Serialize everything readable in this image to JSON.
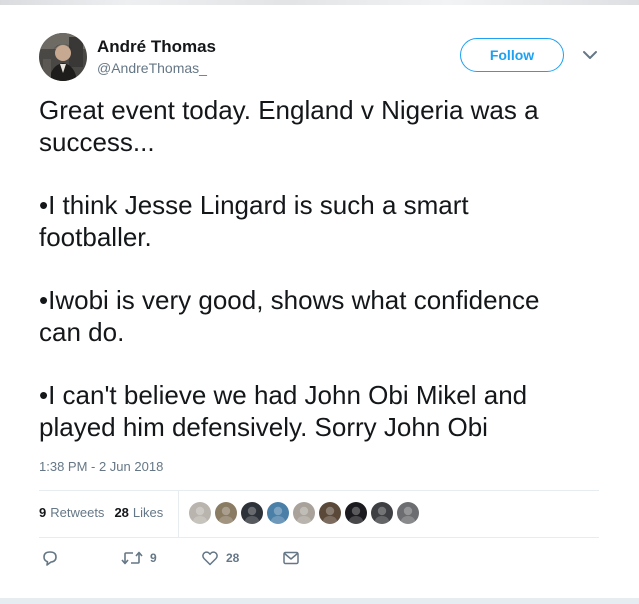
{
  "tweet": {
    "author": {
      "display_name": "André Thomas",
      "handle": "@AndreThomas_"
    },
    "follow_label": "Follow",
    "text_paragraphs": [
      "Great event today. England v Nigeria was a\nsuccess...",
      "•I think Jesse Lingard is such a smart\nfootballer.",
      "•Iwobi is very good, shows what confidence\ncan do.",
      "•I can't believe we had John Obi Mikel and\nplayed him defensively. Sorry John Obi"
    ],
    "timestamp": "1:38 PM - 2 Jun 2018",
    "stats": {
      "retweets_count": "9",
      "retweets_label": "Retweets",
      "likes_count": "28",
      "likes_label": "Likes"
    },
    "actions": {
      "reply_icon": "reply-icon",
      "retweet_icon": "retweet-icon",
      "retweet_count": "9",
      "like_icon": "heart-icon",
      "like_count": "28",
      "dm_icon": "envelope-icon"
    },
    "liker_avatars": [
      {
        "name": "liker-avatar-1",
        "color": "#b9b4ad"
      },
      {
        "name": "liker-avatar-2",
        "color": "#8a7b63"
      },
      {
        "name": "liker-avatar-3",
        "color": "#2d3138"
      },
      {
        "name": "liker-avatar-4",
        "color": "#4a7fa8"
      },
      {
        "name": "liker-avatar-5",
        "color": "#a8a29a"
      },
      {
        "name": "liker-avatar-6",
        "color": "#5a4838"
      },
      {
        "name": "liker-avatar-7",
        "color": "#1b1b1f"
      },
      {
        "name": "liker-avatar-8",
        "color": "#3d3f42"
      },
      {
        "name": "liker-avatar-9",
        "color": "#6b6d70"
      }
    ]
  },
  "colors": {
    "accent": "#1da1f2",
    "text_primary": "#14171a",
    "text_secondary": "#657786",
    "divider": "#e6ecf0"
  }
}
